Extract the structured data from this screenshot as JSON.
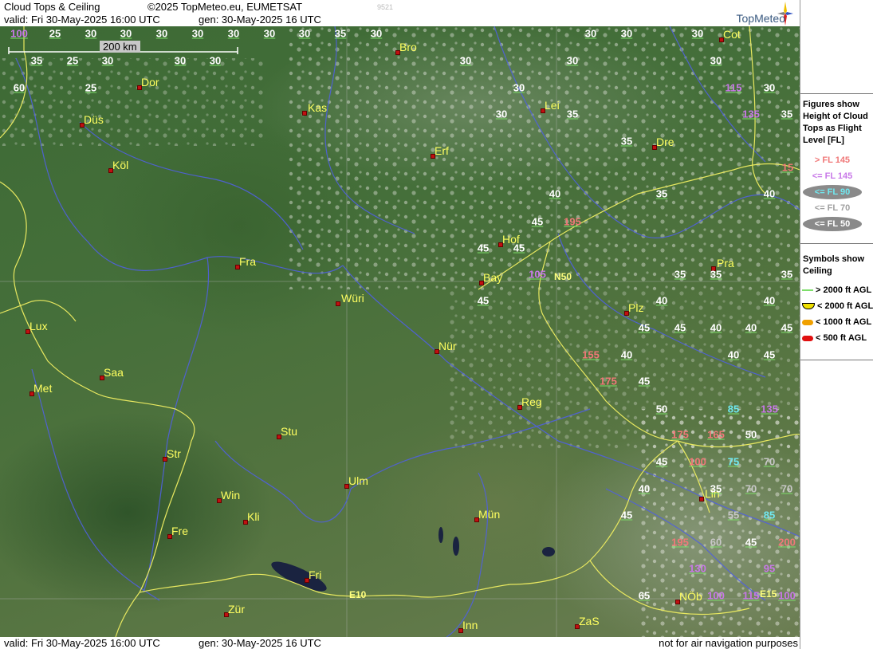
{
  "header": {
    "title": "Cloud Tops & Ceiling",
    "copyright": "©2025 TopMeteo.eu, EUMETSAT",
    "valid": "valid:  Fri  30-May-2025  16:00 UTC",
    "gen": "gen: 30-May-2025 16 UTC",
    "code": "9521",
    "logo": "TopMeteo"
  },
  "footer": {
    "valid": "valid:  Fri  30-May-2025  16:00 UTC",
    "gen": "gen: 30-May-2025 16 UTC",
    "note": "not for air navigation purposes"
  },
  "scale_label": "200 km",
  "sidebar": {
    "tops_title": [
      "Figures show",
      "Height of Cloud",
      "Tops as Flight",
      "Level  [FL]"
    ],
    "tops_legend": [
      {
        "text": "> FL 145",
        "color": "#f07878"
      },
      {
        "text": "<= FL 145",
        "color": "#c878e8"
      },
      {
        "text": "<= FL 90",
        "color": "#70e8f0"
      },
      {
        "text": "<= FL 70",
        "color": "#a0a0a0"
      },
      {
        "text": "<= FL 50",
        "color": "#ffffff"
      }
    ],
    "ceiling_title": [
      "Symbols show",
      "Ceiling"
    ],
    "ceiling_legend": [
      {
        "text": "> 2000 ft AGL",
        "color": "#7dde6a"
      },
      {
        "text": "< 2000 ft AGL",
        "color": "#f0e000"
      },
      {
        "text": "< 1000 ft AGL",
        "color": "#f0a000"
      },
      {
        "text": "< 500 ft AGL",
        "color": "#e01010"
      }
    ]
  },
  "cities": [
    {
      "name": "Bro"
    },
    {
      "name": "Dor"
    },
    {
      "name": "Kas"
    },
    {
      "name": "Lei"
    },
    {
      "name": "Düs"
    },
    {
      "name": "Erf"
    },
    {
      "name": "Dre"
    },
    {
      "name": "Köl"
    },
    {
      "name": "Hof"
    },
    {
      "name": "Fra"
    },
    {
      "name": "Bay"
    },
    {
      "name": "Pra"
    },
    {
      "name": "Würi"
    },
    {
      "name": "Lux"
    },
    {
      "name": "Plz"
    },
    {
      "name": "Nür"
    },
    {
      "name": "Saa"
    },
    {
      "name": "Met"
    },
    {
      "name": "Reg"
    },
    {
      "name": "Stu"
    },
    {
      "name": "Str"
    },
    {
      "name": "Ulm"
    },
    {
      "name": "Win"
    },
    {
      "name": "Lin"
    },
    {
      "name": "Kli"
    },
    {
      "name": "Mün"
    },
    {
      "name": "Fre"
    },
    {
      "name": "Fri"
    },
    {
      "name": "NÖb"
    },
    {
      "name": "Zür"
    },
    {
      "name": "Inn"
    },
    {
      "name": "ZaS"
    },
    {
      "name": "Cot"
    }
  ],
  "roads": [
    "N50",
    "E10",
    "E15"
  ],
  "cloud_tops": [
    "100",
    "25",
    "30",
    "30",
    "30",
    "30",
    "30",
    "30",
    "30",
    "35",
    "30",
    "30",
    "30",
    "30",
    "35",
    "25",
    "30",
    "30",
    "30",
    "30",
    "30",
    "30",
    "60",
    "25",
    "115",
    "30",
    "30",
    "30",
    "135",
    "35",
    "35",
    "35",
    "15",
    "40",
    "35",
    "40",
    "45",
    "195",
    "45",
    "45",
    "105",
    "35",
    "35",
    "35",
    "45",
    "40",
    "40",
    "45",
    "45",
    "40",
    "40",
    "45",
    "155",
    "40",
    "40",
    "45",
    "175",
    "45",
    "50",
    "85",
    "135",
    "175",
    "165",
    "50",
    "45",
    "100",
    "75",
    "70",
    "40",
    "35",
    "70",
    "70",
    "45",
    "55",
    "85",
    "195",
    "60",
    "45",
    "200",
    "130",
    "95",
    "65",
    "100",
    "115",
    "100"
  ]
}
